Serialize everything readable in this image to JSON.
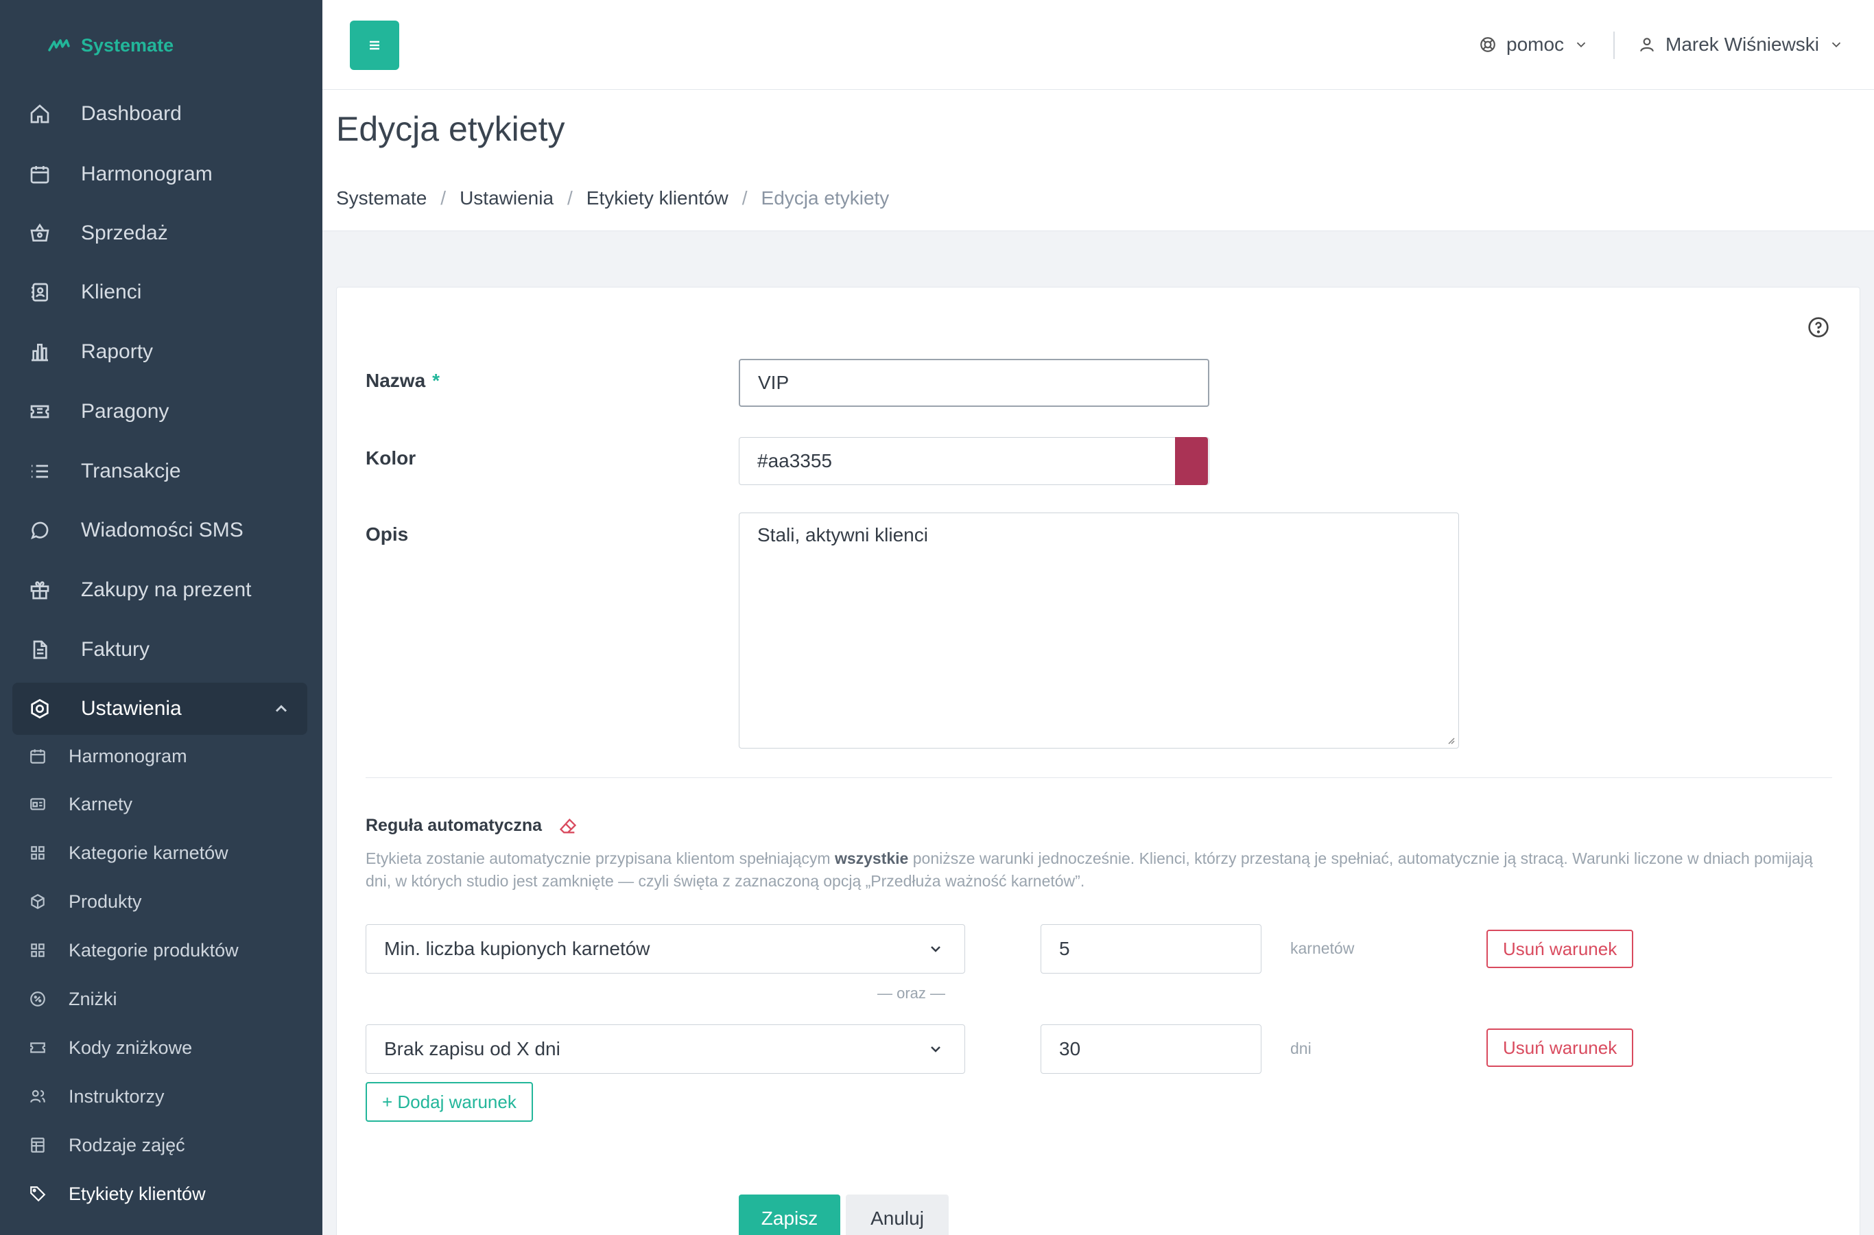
{
  "app": {
    "brand": "Systemate"
  },
  "sidebar": {
    "items": [
      {
        "label": "Dashboard",
        "icon": "home-icon"
      },
      {
        "label": "Harmonogram",
        "icon": "calendar-icon"
      },
      {
        "label": "Sprzedaż",
        "icon": "basket-icon"
      },
      {
        "label": "Klienci",
        "icon": "address-book-icon"
      },
      {
        "label": "Raporty",
        "icon": "bar-chart-icon"
      },
      {
        "label": "Paragony",
        "icon": "ticket-icon"
      },
      {
        "label": "Transakcje",
        "icon": "list-icon"
      },
      {
        "label": "Wiadomości SMS",
        "icon": "chat-icon"
      },
      {
        "label": "Zakupy na prezent",
        "icon": "gift-icon"
      },
      {
        "label": "Faktury",
        "icon": "document-icon"
      },
      {
        "label": "Ustawienia",
        "icon": "settings-icon",
        "expanded": true
      }
    ],
    "subitems": [
      {
        "label": "Harmonogram",
        "icon": "calendar-icon"
      },
      {
        "label": "Karnety",
        "icon": "card-icon"
      },
      {
        "label": "Kategorie karnetów",
        "icon": "grid-icon"
      },
      {
        "label": "Produkty",
        "icon": "box-icon"
      },
      {
        "label": "Kategorie produktów",
        "icon": "grid-icon"
      },
      {
        "label": "Zniżki",
        "icon": "percent-icon"
      },
      {
        "label": "Kody zniżkowe",
        "icon": "ticket-icon"
      },
      {
        "label": "Instruktorzy",
        "icon": "users-icon"
      },
      {
        "label": "Rodzaje zajęć",
        "icon": "table-icon"
      },
      {
        "label": "Etykiety klientów",
        "icon": "tag-icon",
        "active": true
      }
    ]
  },
  "topbar": {
    "help_label": "pomoc",
    "user_name": "Marek Wiśniewski"
  },
  "page": {
    "title": "Edycja etykiety",
    "breadcrumb": [
      "Systemate",
      "Ustawienia",
      "Etykiety klientów",
      "Edycja etykiety"
    ]
  },
  "form": {
    "name_label": "Nazwa",
    "name_required": "*",
    "name_value": "VIP",
    "color_label": "Kolor",
    "color_value": "#aa3355",
    "description_label": "Opis",
    "description_value": "Stali, aktywni klienci"
  },
  "rule": {
    "title": "Reguła automatyczna",
    "desc_part1": "Etykieta zostanie automatycznie przypisana klientom spełniającym ",
    "desc_bold": "wszystkie",
    "desc_part2": " poniższe warunki jednocześnie. Klienci, którzy przestaną je spełniać, automatycznie ją stracą. Warunki liczone w dniach pomijają dni, w których studio jest zamknięte — czyli święta z zaznaczoną opcją „Przedłuża ważność karnetów”.",
    "conditions": [
      {
        "type": "Min. liczba kupionych karnetów",
        "value": "5",
        "unit": "karnetów",
        "remove_label": "Usuń warunek"
      },
      {
        "type": "Brak zapisu od X dni",
        "value": "30",
        "unit": "dni",
        "remove_label": "Usuń warunek"
      }
    ],
    "separator": "— oraz —",
    "add_label": "+ Dodaj warunek"
  },
  "actions": {
    "save_label": "Zapisz",
    "cancel_label": "Anuluj"
  },
  "colors": {
    "accent": "#22b69a",
    "sidebar": "#2e3e4f",
    "danger": "#d94a5e",
    "swatch": "#aa3355"
  }
}
